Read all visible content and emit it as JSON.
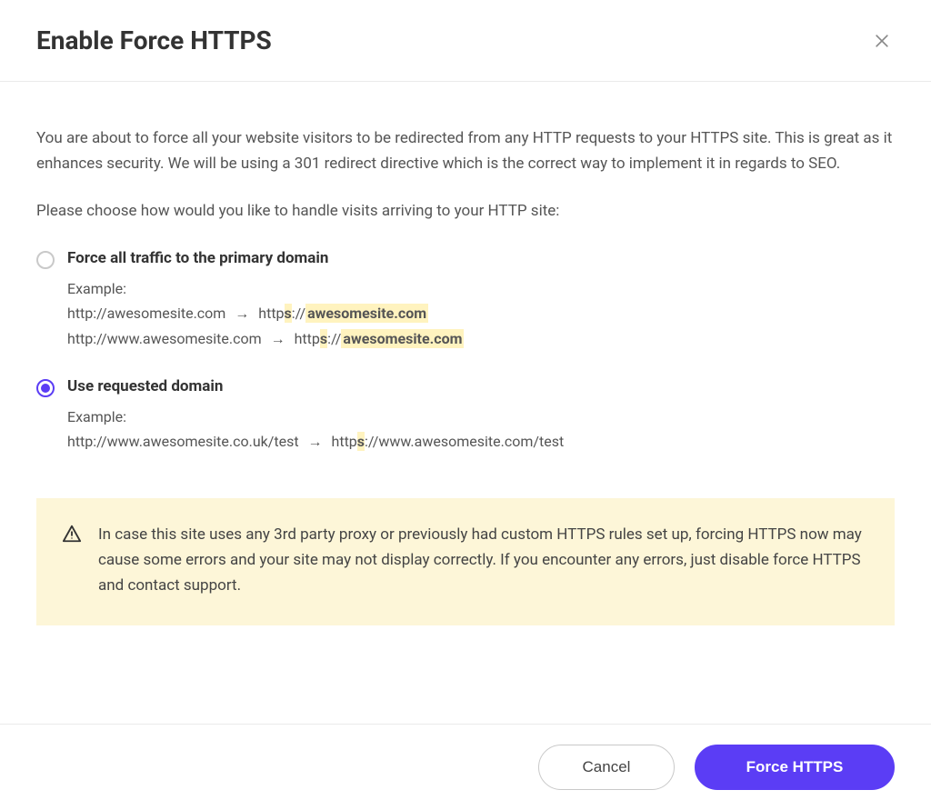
{
  "header": {
    "title": "Enable Force HTTPS"
  },
  "body": {
    "intro": "You are about to force all your website visitors to be redirected from any HTTP requests to your HTTPS site. This is great as it enhances security. We will be using a 301 redirect directive which is the correct way to implement it in regards to SEO.",
    "prompt": "Please choose how would you like to handle visits arriving to your HTTP site:"
  },
  "options": {
    "primary": {
      "label": "Force all traffic to the primary domain",
      "example_heading": "Example:",
      "ex1_from": "http://awesomesite.com",
      "ex1_to_prefix": "http",
      "ex1_to_s": "s",
      "ex1_to_sep": "://",
      "ex1_to_domain": "awesomesite.com",
      "ex2_from": "http://www.awesomesite.com",
      "ex2_to_prefix": "http",
      "ex2_to_s": "s",
      "ex2_to_sep": "://",
      "ex2_to_domain": "awesomesite.com"
    },
    "requested": {
      "label": "Use requested domain",
      "example_heading": "Example:",
      "ex1_from": "http://www.awesomesite.co.uk/test",
      "ex1_to_prefix": "http",
      "ex1_to_s": "s",
      "ex1_to_rest": "://www.awesomesite.com/test"
    },
    "selected": "requested"
  },
  "warning": {
    "text": "In case this site uses any 3rd party proxy or previously had custom HTTPS rules set up, forcing HTTPS now may cause some errors and your site may not display correctly. If you encounter any errors, just disable force HTTPS and contact support."
  },
  "footer": {
    "cancel": "Cancel",
    "confirm": "Force HTTPS"
  },
  "glyphs": {
    "arrow": "→"
  }
}
